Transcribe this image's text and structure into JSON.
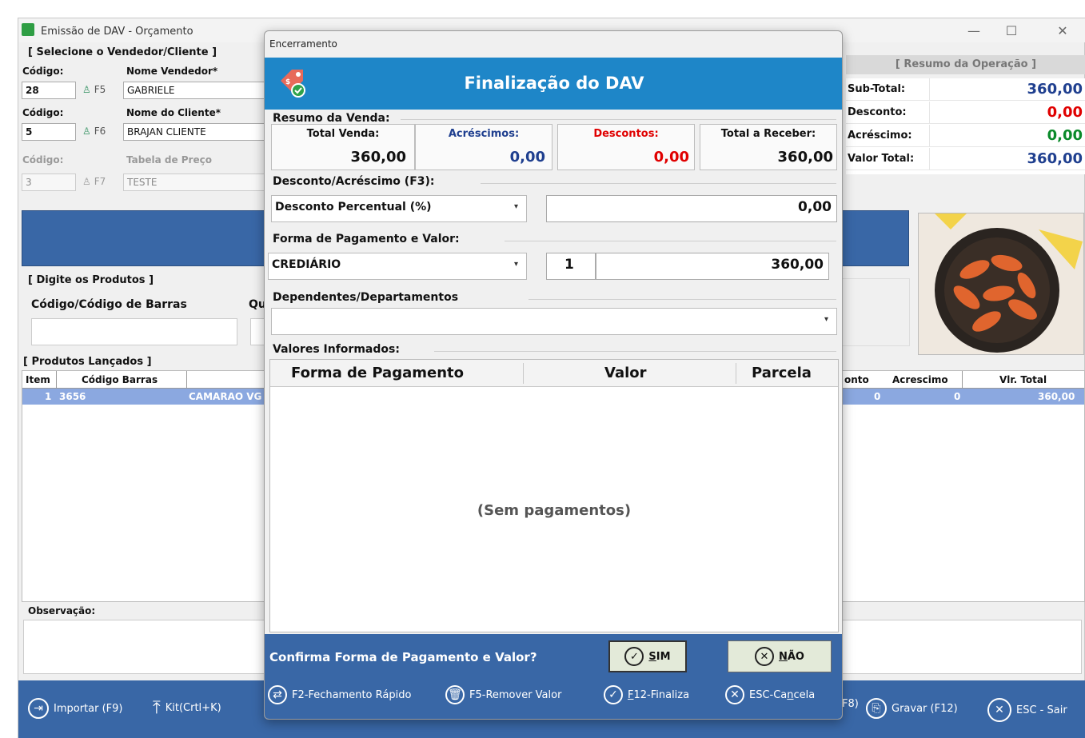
{
  "window": {
    "title": "Emissão de DAV - Orçamento",
    "controls": {
      "minimize": "—",
      "maximize": "☐",
      "close": "✕"
    }
  },
  "seller_client": {
    "section_title": "[ Selecione o Vendedor/Cliente ]",
    "codigo_label": "Código:",
    "vendedor": {
      "label": "Nome Vendedor*",
      "code": "28",
      "key": "F5",
      "name": "GABRIELE"
    },
    "cliente": {
      "label": "Nome do Cliente*",
      "code": "5",
      "key": "F6",
      "name": "BRAJAN CLIENTE"
    },
    "tabela": {
      "label": "Tabela de Preço",
      "code": "3",
      "key": "F7",
      "name": "TESTE"
    }
  },
  "summary_panel": {
    "title": "[ Resumo da Operação ]",
    "rows": [
      {
        "label": "Sub-Total:",
        "value": "360,00",
        "color": "#1f3f8f"
      },
      {
        "label": "Desconto:",
        "value": "0,00",
        "color": "#e00000"
      },
      {
        "label": "Acréscimo:",
        "value": "0,00",
        "color": "#0a8a2a"
      },
      {
        "label": "Valor Total:",
        "value": "360,00",
        "color": "#1f3f8f"
      }
    ]
  },
  "products_input": {
    "section_title": "[ Digite os Produtos ]",
    "barcode_label": "Código/Código de Barras",
    "qty_label_partial": "Qu"
  },
  "products_grid": {
    "section_title": "[ Produtos Lançados ]",
    "headers": {
      "item": "Item",
      "barcode": "Código Barras",
      "discount_partial": "onto",
      "acrescimo": "Acrescimo",
      "total": "Vlr. Total"
    },
    "rows": [
      {
        "item": "1",
        "barcode": "3656",
        "desc_partial": "CAMARAO VG",
        "discount": "0",
        "acrescimo": "0",
        "total": "360,00"
      }
    ]
  },
  "observacao": {
    "label": "Observação:"
  },
  "footer": {
    "importar": "Importar (F9)",
    "kit": "Kit(Crtl+K)",
    "f8_partial": "F8)",
    "gravar": "Gravar (F12)",
    "sair": "ESC - Sair"
  },
  "dialog": {
    "title": "Encerramento",
    "heading": "Finalização do DAV",
    "resumo": {
      "title": "Resumo da Venda:",
      "total_venda_label": "Total Venda:",
      "total_venda": "360,00",
      "acrescimos_label": "Acréscimos:",
      "acrescimos": "0,00",
      "descontos_label": "Descontos:",
      "descontos": "0,00",
      "total_receber_label": "Total a Receber:",
      "total_receber": "360,00"
    },
    "desconto": {
      "title": "Desconto/Acréscimo (F3):",
      "type_selected": "Desconto Percentual (%)",
      "value": "0,00"
    },
    "pagamento": {
      "title": "Forma de Pagamento e Valor:",
      "method_selected": "CREDIÁRIO",
      "parcelas": "1",
      "value": "360,00"
    },
    "dependentes": {
      "title": "Dependentes/Departamentos",
      "selected": ""
    },
    "valores": {
      "title": "Valores Informados:",
      "headers": {
        "forma": "Forma de Pagamento",
        "valor": "Valor",
        "parcela": "Parcela"
      },
      "empty_text": "(Sem  pagamentos)"
    },
    "confirm": {
      "question": "Confirma Forma de Pagamento e Valor?",
      "yes_key": "S",
      "yes_rest": "IM",
      "no_key": "N",
      "no_rest": "ÃO"
    },
    "shortcuts": {
      "fechamento": "F2-Fechamento Rápido",
      "remover": "F5-Remover Valor",
      "finaliza_key": "F",
      "finaliza_rest": "12-Finaliza",
      "cancela_pre": "ESC-Ca",
      "cancela_key": "n",
      "cancela_post": "cela"
    }
  }
}
